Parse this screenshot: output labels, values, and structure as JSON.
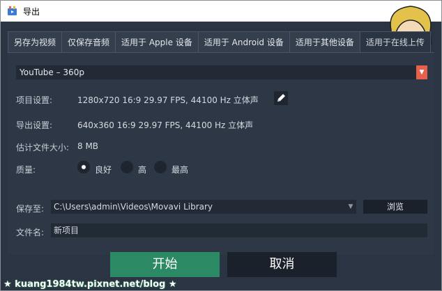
{
  "window": {
    "title": "导出",
    "close_glyph": "✕"
  },
  "tabs": [
    {
      "label": "另存为视频",
      "active": false
    },
    {
      "label": "仅保存音频",
      "active": false
    },
    {
      "label": "适用于 Apple 设备",
      "active": false
    },
    {
      "label": "适用于 Android 设备",
      "active": false
    },
    {
      "label": "适用于其他设备",
      "active": false
    },
    {
      "label": "适用于在线上传",
      "active": true
    }
  ],
  "preset": {
    "value": "YouTube – 360p",
    "arrow": "▼"
  },
  "project_settings": {
    "label": "项目设置:",
    "value": "1280x720 16:9 29.97 FPS, 44100 Hz 立体声"
  },
  "export_settings": {
    "label": "导出设置:",
    "value": "640x360 16:9 29.97 FPS, 44100 Hz 立体声"
  },
  "estimated_size": {
    "label": "估计文件大小:",
    "value": "8 MB"
  },
  "quality": {
    "label": "质量:",
    "options": [
      {
        "label": "良好",
        "checked": true
      },
      {
        "label": "高",
        "checked": false
      },
      {
        "label": "最高",
        "checked": false
      }
    ]
  },
  "save_to": {
    "label": "保存至:",
    "value": "C:\\Users\\admin\\Videos\\Movavi Library",
    "arrow": "▼",
    "browse_label": "浏览"
  },
  "file_name": {
    "label": "文件名:",
    "value": "新项目"
  },
  "actions": {
    "start_label": "开始",
    "cancel_label": "取消"
  },
  "watermark": {
    "text": "★ kuang1984tw.pixnet.net/blog ★"
  },
  "colors": {
    "accent_green": "#2b8a64",
    "preset_arrow": "#e8604c",
    "background": "#2b3442"
  }
}
